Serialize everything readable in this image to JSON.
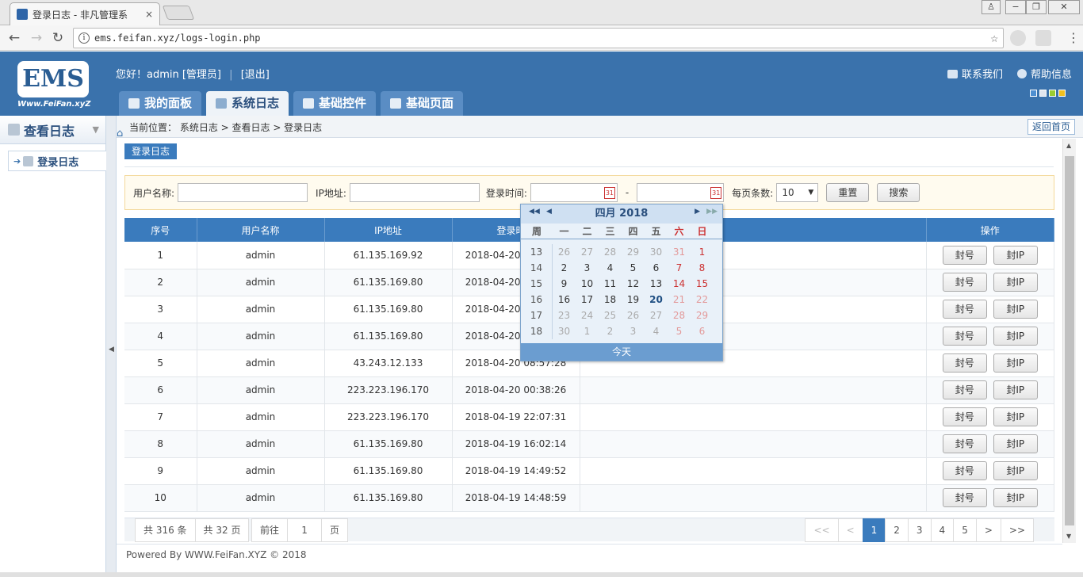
{
  "browser": {
    "tab_title": "登录日志 - 非凡管理系",
    "url": "ems.feifan.xyz/logs-login.php"
  },
  "header": {
    "logo_text": "EMS",
    "logo_sub": "Www.FeiFan.xyZ",
    "greeting": "您好！admin [管理员]",
    "logout": "[退出]",
    "contact": "联系我们",
    "help": "帮助信息",
    "tabs": [
      "我的面板",
      "系统日志",
      "基础控件",
      "基础页面"
    ],
    "skin_colors": [
      "#4f8fd0",
      "#e0e6ee",
      "#9acd32",
      "#f0c020"
    ]
  },
  "sidebar": {
    "title": "查看日志",
    "items": [
      "登录日志"
    ]
  },
  "breadcrumb": {
    "text": "当前位置： 系统日志 > 查看日志 > 登录日志",
    "back_home": "返回首页"
  },
  "content": {
    "title": "登录日志"
  },
  "filter": {
    "username_label": "用户名称:",
    "ip_label": "IP地址:",
    "time_label": "登录时间:",
    "dash": "-",
    "perpage_label": "每页条数:",
    "perpage_value": "10",
    "reset": "重置",
    "search": "搜索",
    "cal_icon_text": "31"
  },
  "table": {
    "columns": [
      "序号",
      "用户名称",
      "IP地址",
      "登录时间",
      "",
      "操作"
    ],
    "btn_ban_user": "封号",
    "btn_ban_ip": "封IP",
    "rows": [
      {
        "no": "1",
        "user": "admin",
        "ip": "61.135.169.92",
        "time": "2018-04-20 16:41:22"
      },
      {
        "no": "2",
        "user": "admin",
        "ip": "61.135.169.80",
        "time": "2018-04-20 15:30:11"
      },
      {
        "no": "3",
        "user": "admin",
        "ip": "61.135.169.80",
        "time": "2018-04-20 13:22:40"
      },
      {
        "no": "4",
        "user": "admin",
        "ip": "61.135.169.80",
        "time": "2018-04-20 10:05:17"
      },
      {
        "no": "5",
        "user": "admin",
        "ip": "43.243.12.133",
        "time": "2018-04-20 08:57:28"
      },
      {
        "no": "6",
        "user": "admin",
        "ip": "223.223.196.170",
        "time": "2018-04-20 00:38:26"
      },
      {
        "no": "7",
        "user": "admin",
        "ip": "223.223.196.170",
        "time": "2018-04-19 22:07:31"
      },
      {
        "no": "8",
        "user": "admin",
        "ip": "61.135.169.80",
        "time": "2018-04-19 16:02:14"
      },
      {
        "no": "9",
        "user": "admin",
        "ip": "61.135.169.80",
        "time": "2018-04-19 14:49:52"
      },
      {
        "no": "10",
        "user": "admin",
        "ip": "61.135.169.80",
        "time": "2018-04-19 14:48:59"
      }
    ]
  },
  "pager": {
    "total": "共 316 条",
    "pages": "共 32 页",
    "goto": "前往",
    "goto_value": "1",
    "page_unit": "页",
    "first": "<<",
    "prev": "<",
    "numbers": [
      "1",
      "2",
      "3",
      "4",
      "5"
    ],
    "current": "1",
    "next": ">",
    "last": ">>"
  },
  "footer": "Powered By WWW.FeiFan.XYZ © 2018",
  "calendar": {
    "title": "四月 2018",
    "week_label": "周",
    "weekdays": [
      "一",
      "二",
      "三",
      "四",
      "五",
      "六",
      "日"
    ],
    "today_label": "今天",
    "weeks": [
      {
        "wk": "13",
        "days": [
          "26",
          "27",
          "28",
          "29",
          "30",
          "31",
          "1"
        ],
        "other": [
          1,
          1,
          1,
          1,
          1,
          1,
          0
        ]
      },
      {
        "wk": "14",
        "days": [
          "2",
          "3",
          "4",
          "5",
          "6",
          "7",
          "8"
        ],
        "other": [
          0,
          0,
          0,
          0,
          0,
          0,
          0
        ]
      },
      {
        "wk": "15",
        "days": [
          "9",
          "10",
          "11",
          "12",
          "13",
          "14",
          "15"
        ],
        "other": [
          0,
          0,
          0,
          0,
          0,
          0,
          0
        ]
      },
      {
        "wk": "16",
        "days": [
          "16",
          "17",
          "18",
          "19",
          "20",
          "21",
          "22"
        ],
        "other": [
          0,
          0,
          0,
          0,
          0,
          1,
          1
        ]
      },
      {
        "wk": "17",
        "days": [
          "23",
          "24",
          "25",
          "26",
          "27",
          "28",
          "29"
        ],
        "other": [
          1,
          1,
          1,
          1,
          1,
          1,
          1
        ]
      },
      {
        "wk": "18",
        "days": [
          "30",
          "1",
          "2",
          "3",
          "4",
          "5",
          "6"
        ],
        "other": [
          1,
          1,
          1,
          1,
          1,
          1,
          1
        ]
      }
    ],
    "today": "20"
  }
}
